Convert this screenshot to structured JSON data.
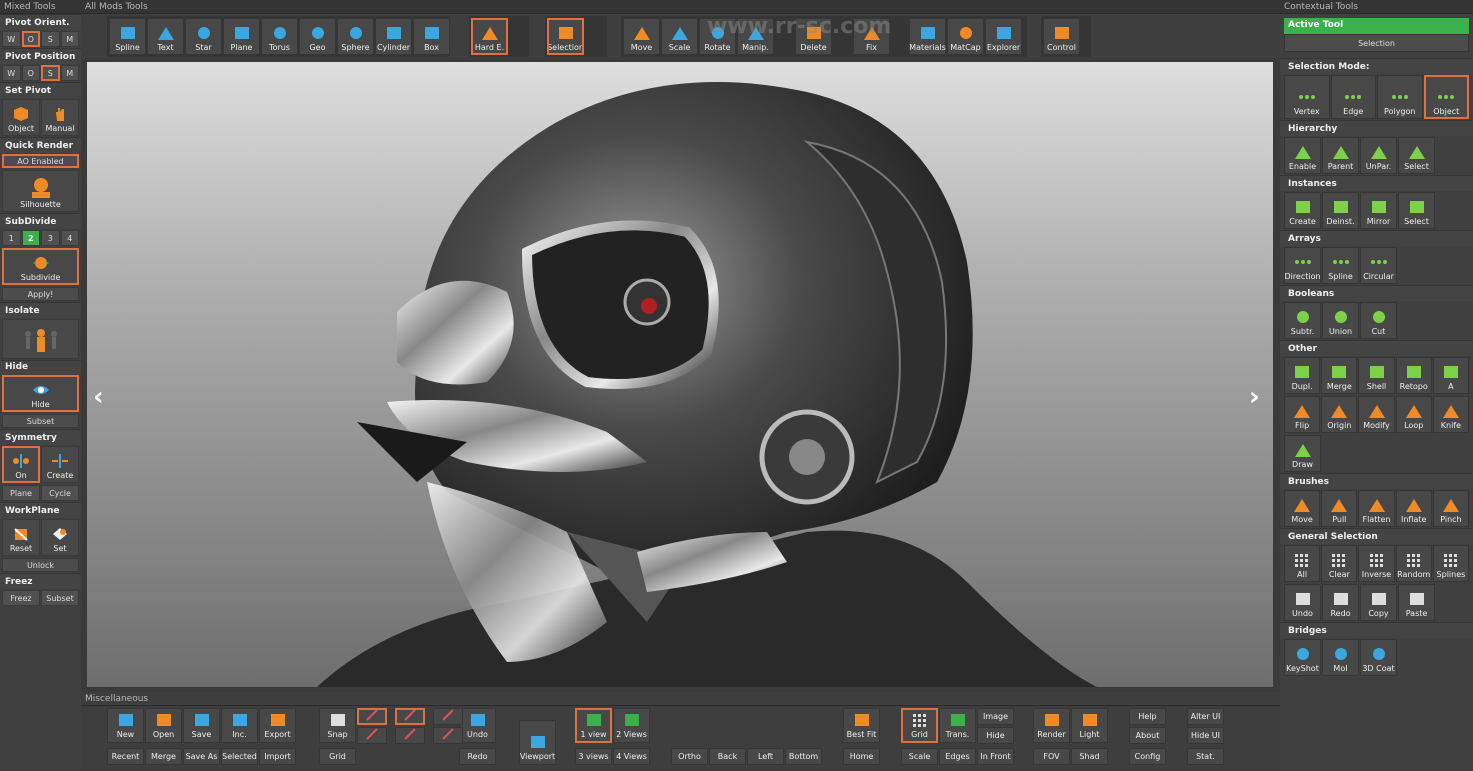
{
  "titles": {
    "left": "Mixed Tools",
    "top": "All Mods Tools",
    "right": "Contextual Tools",
    "bottom": "Miscellaneous"
  },
  "watermark": "www.rr-sc.com",
  "left": {
    "pivot_orient": "Pivot Orient.",
    "pivot_orient_opts": [
      "W",
      "O",
      "S",
      "M"
    ],
    "pivot_pos": "Pivot Position",
    "pivot_pos_opts": [
      "W",
      "O",
      "S",
      "M"
    ],
    "set_pivot": "Set Pivot",
    "object": "Object",
    "manual": "Manual",
    "quick_render": "Quick Render",
    "ao": "AO Enabled",
    "silhouette": "Silhouette",
    "subdivide_title": "SubDivide",
    "levels": [
      "1",
      "2",
      "3",
      "4"
    ],
    "subdivide": "Subdivide",
    "apply": "Apply!",
    "isolate": "Isolate",
    "hide_title": "Hide",
    "hide": "Hide",
    "subset": "Subset",
    "symmetry": "Symmetry",
    "on": "On",
    "create": "Create",
    "plane": "Plane",
    "cycle": "Cycle",
    "workplane": "WorkPlane",
    "reset": "Reset",
    "set": "Set",
    "unlock": "Unlock",
    "freez": "Freez",
    "freez_btn": "Freez",
    "freez_subset": "Subset"
  },
  "top": [
    "Spline",
    "Text",
    "Star",
    "Plane",
    "Torus",
    "Geo",
    "Sphere",
    "Cylinder",
    "Box",
    "Hard E.",
    "Selection",
    "Move",
    "Scale",
    "Rotate",
    "Manip.",
    "Delete",
    "Fix",
    "Materials",
    "MatCap",
    "Explorer",
    "Control"
  ],
  "right": {
    "active_tool": "Active Tool",
    "selection": "Selection",
    "selection_mode": "Selection Mode:",
    "modes": [
      "Vertex",
      "Edge",
      "Polygon",
      "Object"
    ],
    "hierarchy": "Hierarchy",
    "hier": [
      "Enable",
      "Parent",
      "UnPar.",
      "Select"
    ],
    "instances": "Instances",
    "inst": [
      "Create",
      "Deinst.",
      "Mirror",
      "Select"
    ],
    "arrays": "Arrays",
    "arr": [
      "Direction",
      "Spline",
      "Circular"
    ],
    "booleans": "Booleans",
    "bool": [
      "Subtr.",
      "Union",
      "Cut"
    ],
    "other": "Other",
    "other1": [
      "Dupl.",
      "Merge",
      "Shell",
      "Retopo",
      "A"
    ],
    "other2": [
      "Flip",
      "Origin",
      "Modify",
      "Loop",
      "Knife"
    ],
    "other3": [
      "Draw"
    ],
    "brushes": "Brushes",
    "br": [
      "Move",
      "Pull",
      "Flatten",
      "Inflate",
      "Pinch"
    ],
    "gensel": "General Selection",
    "gs1": [
      "All",
      "Clear",
      "Inverse",
      "Random",
      "Splines"
    ],
    "gs2": [
      "Undo",
      "Redo",
      "Copy",
      "Paste"
    ],
    "bridges": "Bridges",
    "bridge": [
      "KeyShot",
      "MoI",
      "3D Coat"
    ]
  },
  "bottom": {
    "top_row": [
      "New",
      "Open",
      "Save",
      "Inc.",
      "Export",
      "Snap",
      "Undo",
      "1 view",
      "2 Views",
      "Render",
      "Light",
      "Help",
      "Alter UI",
      "Best Fit",
      "Grid",
      "Trans.",
      "Image",
      "Hide",
      "About",
      "Hide UI"
    ],
    "bot_row": [
      "Recent",
      "Merge",
      "Save As",
      "Selected",
      "Import",
      "Grid",
      "Redo",
      "Viewport",
      "3 views",
      "4 Views",
      "Ortho",
      "Back",
      "Left",
      "Bottom",
      "Home",
      "Scale",
      "Edges",
      "In Front",
      "FOV",
      "Shad",
      "Config",
      "Stat."
    ]
  },
  "colors": {
    "accent": "#e07040",
    "green": "#3ab14a",
    "icon_orange": "#f08a24",
    "icon_blue": "#3aa7e0"
  }
}
